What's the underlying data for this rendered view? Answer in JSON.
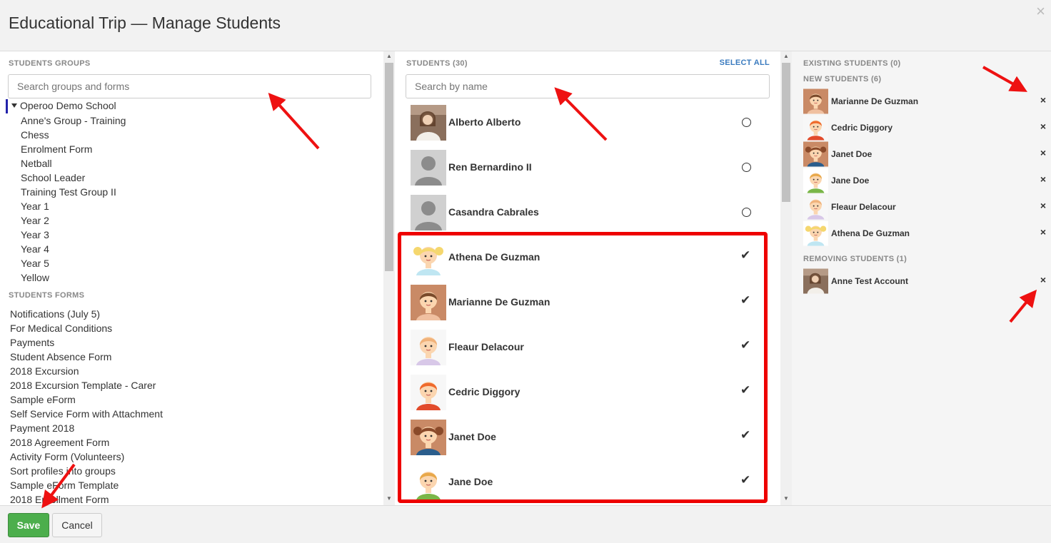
{
  "dialog": {
    "title": "Educational Trip — Manage Students",
    "close_icon": "×"
  },
  "groups": {
    "title": "STUDENTS GROUPS",
    "search_placeholder": "Search groups and forms",
    "root": "Operoo Demo School",
    "items": [
      "Anne's Group - Training",
      "Chess",
      "Enrolment Form",
      "Netball",
      "School Leader",
      "Training Test Group II",
      "Year 1",
      "Year 2",
      "Year 3",
      "Year 4",
      "Year 5",
      "Yellow"
    ]
  },
  "forms": {
    "title": "STUDENTS FORMS",
    "items": [
      "Notifications (July 5)",
      "For Medical Conditions",
      "Payments",
      "Student Absence Form",
      "2018 Excursion",
      "2018 Excursion Template - Carer",
      "Sample eForm",
      "Self Service Form with Attachment",
      "Payment 2018",
      "2018 Agreement Form",
      "Activity Form (Volunteers)",
      "Sort profiles into groups",
      "Sample eForm Template",
      "2018 Enrollment Form"
    ]
  },
  "students": {
    "title": "STUDENTS (30)",
    "select_all": "SELECT ALL",
    "search_placeholder": "Search by name",
    "list": [
      {
        "name": "Alberto Alberto",
        "selected": false,
        "avatar": "photo"
      },
      {
        "name": "Ren Bernardino II",
        "selected": false,
        "avatar": "silhouette"
      },
      {
        "name": "Casandra Cabrales",
        "selected": false,
        "avatar": "silhouette"
      },
      {
        "name": "Athena De Guzman",
        "selected": true,
        "avatar": "girl-blonde-pigtails"
      },
      {
        "name": "Marianne De Guzman",
        "selected": true,
        "avatar": "girl-brown"
      },
      {
        "name": "Fleaur Delacour",
        "selected": true,
        "avatar": "girl-ginger"
      },
      {
        "name": "Cedric Diggory",
        "selected": true,
        "avatar": "boy-ginger"
      },
      {
        "name": "Janet Doe",
        "selected": true,
        "avatar": "girl-brown-pigtails"
      },
      {
        "name": "Jane Doe",
        "selected": true,
        "avatar": "girl-blonde"
      }
    ],
    "check_icon": "✔"
  },
  "right": {
    "existing_title": "EXISTING STUDENTS (0)",
    "new_title": "NEW STUDENTS (6)",
    "new_list": [
      {
        "name": "Marianne De Guzman",
        "avatar": "girl-brown"
      },
      {
        "name": "Cedric Diggory",
        "avatar": "boy-ginger"
      },
      {
        "name": "Janet Doe",
        "avatar": "girl-brown-pigtails"
      },
      {
        "name": "Jane Doe",
        "avatar": "girl-blonde"
      },
      {
        "name": "Fleaur Delacour",
        "avatar": "girl-ginger"
      },
      {
        "name": "Athena De Guzman",
        "avatar": "girl-blonde-pigtails"
      }
    ],
    "removing_title": "REMOVING STUDENTS (1)",
    "removing_list": [
      {
        "name": "Anne Test Account",
        "avatar": "photo"
      }
    ],
    "remove_icon": "×"
  },
  "footer": {
    "save": "Save",
    "cancel": "Cancel"
  },
  "colors": {
    "accent_link": "#3a7bbf",
    "save_green": "#4cae4c",
    "highlight_red": "#ee0000",
    "annotation_arrow": "#ee1111"
  }
}
